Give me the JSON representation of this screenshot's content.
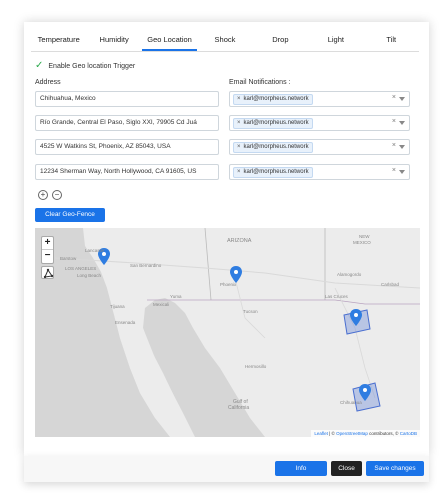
{
  "tabs": [
    "Temperature",
    "Humidity",
    "Geo Location",
    "Shock",
    "Drop",
    "Light",
    "Tilt"
  ],
  "active_tab": "Geo Location",
  "trigger_label": "Enable Geo location Trigger",
  "address_label": "Address",
  "email_label": "Email Notifications :",
  "rows": [
    {
      "address": "Chihuahua, Mexico",
      "email": "karl@morpheus.network"
    },
    {
      "address": "Río Grande, Central El Paso, Siglo XXI, 79905 Cd Juá",
      "email": "karl@morpheus.network"
    },
    {
      "address": "4525 W Watkins St, Phoenix, AZ 85043, USA",
      "email": "karl@morpheus.network"
    },
    {
      "address": "12234 Sherman Way, North Hollywood, CA 91605, US",
      "email": "karl@morpheus.network"
    }
  ],
  "chip_remove": "×",
  "clear_icon": "×",
  "plus_symbol": "+",
  "minus_symbol": "−",
  "clear_geofence": "Clear Geo-Fence",
  "zoom_in": "+",
  "zoom_out": "−",
  "map_labels": {
    "arizona": "ARIZONA",
    "new_mexico": "NEW\nMEXICO",
    "phoenix": "Phoenix",
    "tucson": "Tucson",
    "los_angeles": "LOS ANGELES",
    "san_bernardino": "San Bernardino",
    "lancaster": "Lancaster",
    "barstow": "Barstow",
    "long_beach": "Long Beach",
    "mexicali": "Mexicali",
    "tijuana": "Tijuana",
    "ensenada": "Ensenada",
    "hermosillo": "Hermosillo",
    "chihuahua": "Chihuahua",
    "alamogordo": "Alamogordo",
    "carlsbad": "Carlsbad",
    "las_cruces": "Las Cruces",
    "yuma": "Yuma",
    "gulf": "Gulf of\nCalifornia"
  },
  "attribution": {
    "leaflet": "Leaflet",
    "sep": " | © ",
    "osm": "OpenStreetMap",
    "contrib": " contributors, © ",
    "carto": "CartoDB"
  },
  "footer": {
    "info": "Info",
    "close": "Close",
    "save": "Save changes"
  },
  "colors": {
    "primary": "#1a73e8",
    "close": "#222222",
    "pin": "#2f7de1",
    "fence": "#5b7fd6"
  }
}
